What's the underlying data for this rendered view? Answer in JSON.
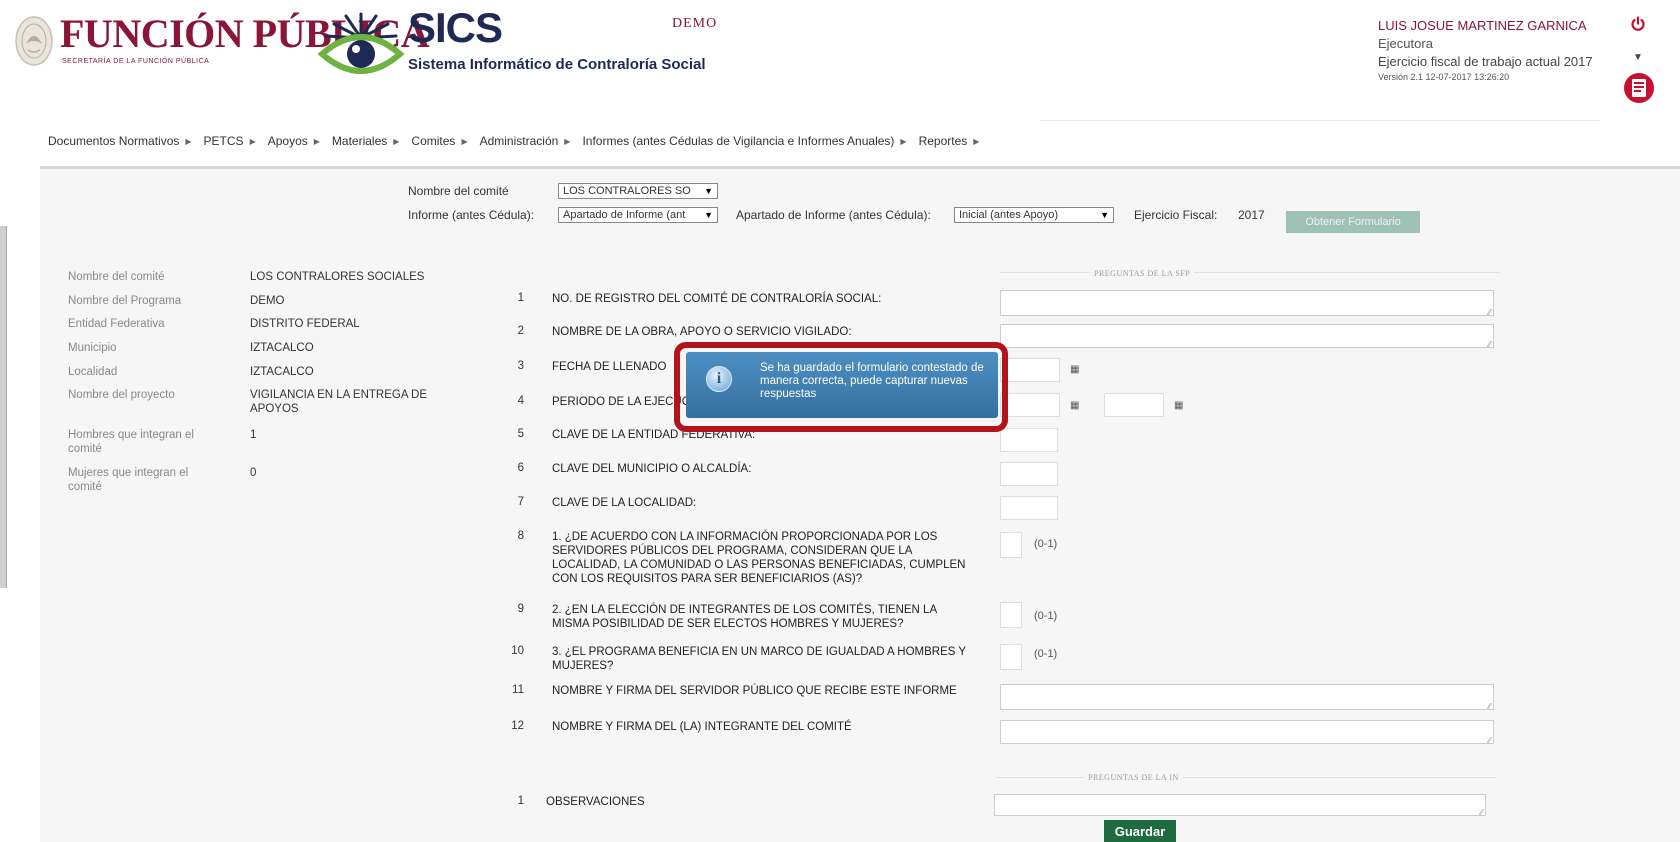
{
  "header": {
    "org_title": "FUNCIÓN PÚBLICA",
    "org_subtitle": "SECRETARÍA DE LA FUNCIÓN PÚBLICA",
    "app_title": "SICS",
    "app_subtitle": "Sistema Informático de Contraloría Social",
    "program_label": "DEMO",
    "user_name": "LUIS JOSUE MARTINEZ GARNICA",
    "user_role": "Ejecutora",
    "fiscal_year_text": "Ejercicio fiscal de trabajo actual  2017",
    "version_text": "Versión 2.1   12-07-2017 13:26:20",
    "colors": {
      "brand": "#8a1538",
      "navy": "#1e2a55",
      "eye_green": "#6cb33f"
    }
  },
  "nav": {
    "items": [
      "Documentos Normativos",
      "PETCS",
      "Apoyos",
      "Materiales",
      "Comites",
      "Administración",
      "Informes (antes Cédulas de Vigilancia e Informes Anuales)",
      "Reportes"
    ],
    "arrow_glyph": "▶"
  },
  "filters": {
    "committee_label": "Nombre del comité",
    "committee_value": "LOS CONTRALORES SO",
    "report_label": "Informe (antes Cédula):",
    "report_value": "Apartado de Informe (ant",
    "section_label": "Apartado de Informe (antes Cédula):",
    "section_value": "Inicial (antes Apoyo)",
    "fiscal_label": "Ejercicio Fiscal:",
    "fiscal_value": "2017",
    "obtain_button": "Obtener Formulario"
  },
  "info": {
    "rows": [
      {
        "label": "Nombre del comité",
        "value": "LOS CONTRALORES SOCIALES"
      },
      {
        "label": "Nombre del Programa",
        "value": "DEMO"
      },
      {
        "label": "Entidad Federativa",
        "value": "DISTRITO FEDERAL"
      },
      {
        "label": "Municipio",
        "value": "IZTACALCO"
      },
      {
        "label": "Localidad",
        "value": "IZTACALCO"
      },
      {
        "label": "Nombre del proyecto",
        "value": "VIGILANCIA EN LA ENTREGA DE APOYOS"
      },
      {
        "label": "Hombres que integran el comité",
        "value": "1"
      },
      {
        "label": "Mujeres que integran el comité",
        "value": "0"
      }
    ]
  },
  "sections": {
    "sfp_header": "PREGUNTAS DE LA SFP",
    "in_header": "PREGUNTAS DE LA IN"
  },
  "questions": [
    {
      "num": "1",
      "text": "NO. DE REGISTRO DEL COMITÉ DE CONTRALORÍA SOCIAL:"
    },
    {
      "num": "2",
      "text": "NOMBRE DE LA OBRA, APOYO O SERVICIO VIGILADO:"
    },
    {
      "num": "3",
      "text": "FECHA DE LLENADO"
    },
    {
      "num": "4",
      "text": "PERIODO DE LA EJECUCIÓN"
    },
    {
      "num": "5",
      "text": "CLAVE DE LA ENTIDAD FEDERATIVA:"
    },
    {
      "num": "6",
      "text": "CLAVE DEL MUNICIPIO O ALCALDÍA:"
    },
    {
      "num": "7",
      "text": "CLAVE DE LA LOCALIDAD:"
    },
    {
      "num": "8",
      "text": "1. ¿DE ACUERDO CON LA INFORMACIÓN PROPORCIONADA POR LOS SERVIDORES PÚBLICOS DEL PROGRAMA, CONSIDERAN QUE LA LOCALIDAD, LA COMUNIDAD O LAS PERSONAS BENEFICIADAS, CUMPLEN CON LOS REQUISITOS PARA SER BENEFICIARIOS (AS)?",
      "range": "(0-1)"
    },
    {
      "num": "9",
      "text": "2. ¿EN LA ELECCIÓN DE INTEGRANTES DE LOS COMITÉS, TIENEN LA MISMA POSIBILIDAD DE SER ELECTOS HOMBRES Y MUJERES?",
      "range": "(0-1)"
    },
    {
      "num": "10",
      "text": "3. ¿EL PROGRAMA BENEFICIA EN UN MARCO DE IGUALDAD A HOMBRES Y MUJERES?",
      "range": "(0-1)"
    },
    {
      "num": "11",
      "text": "NOMBRE Y FIRMA DEL SERVIDOR PÚBLICO QUE RECIBE ESTE INFORME"
    },
    {
      "num": "12",
      "text": "NOMBRE Y FIRMA DEL (LA) INTEGRANTE DEL COMITÉ"
    }
  ],
  "in_questions": [
    {
      "num": "1",
      "text": "OBSERVACIONES"
    }
  ],
  "save_button": "Guardar",
  "toast": {
    "message": "Se ha guardado el formulario contestado de manera correcta, puede capturar nuevas respuestas",
    "icon": "info-icon",
    "highlight_color": "#b3141c"
  }
}
